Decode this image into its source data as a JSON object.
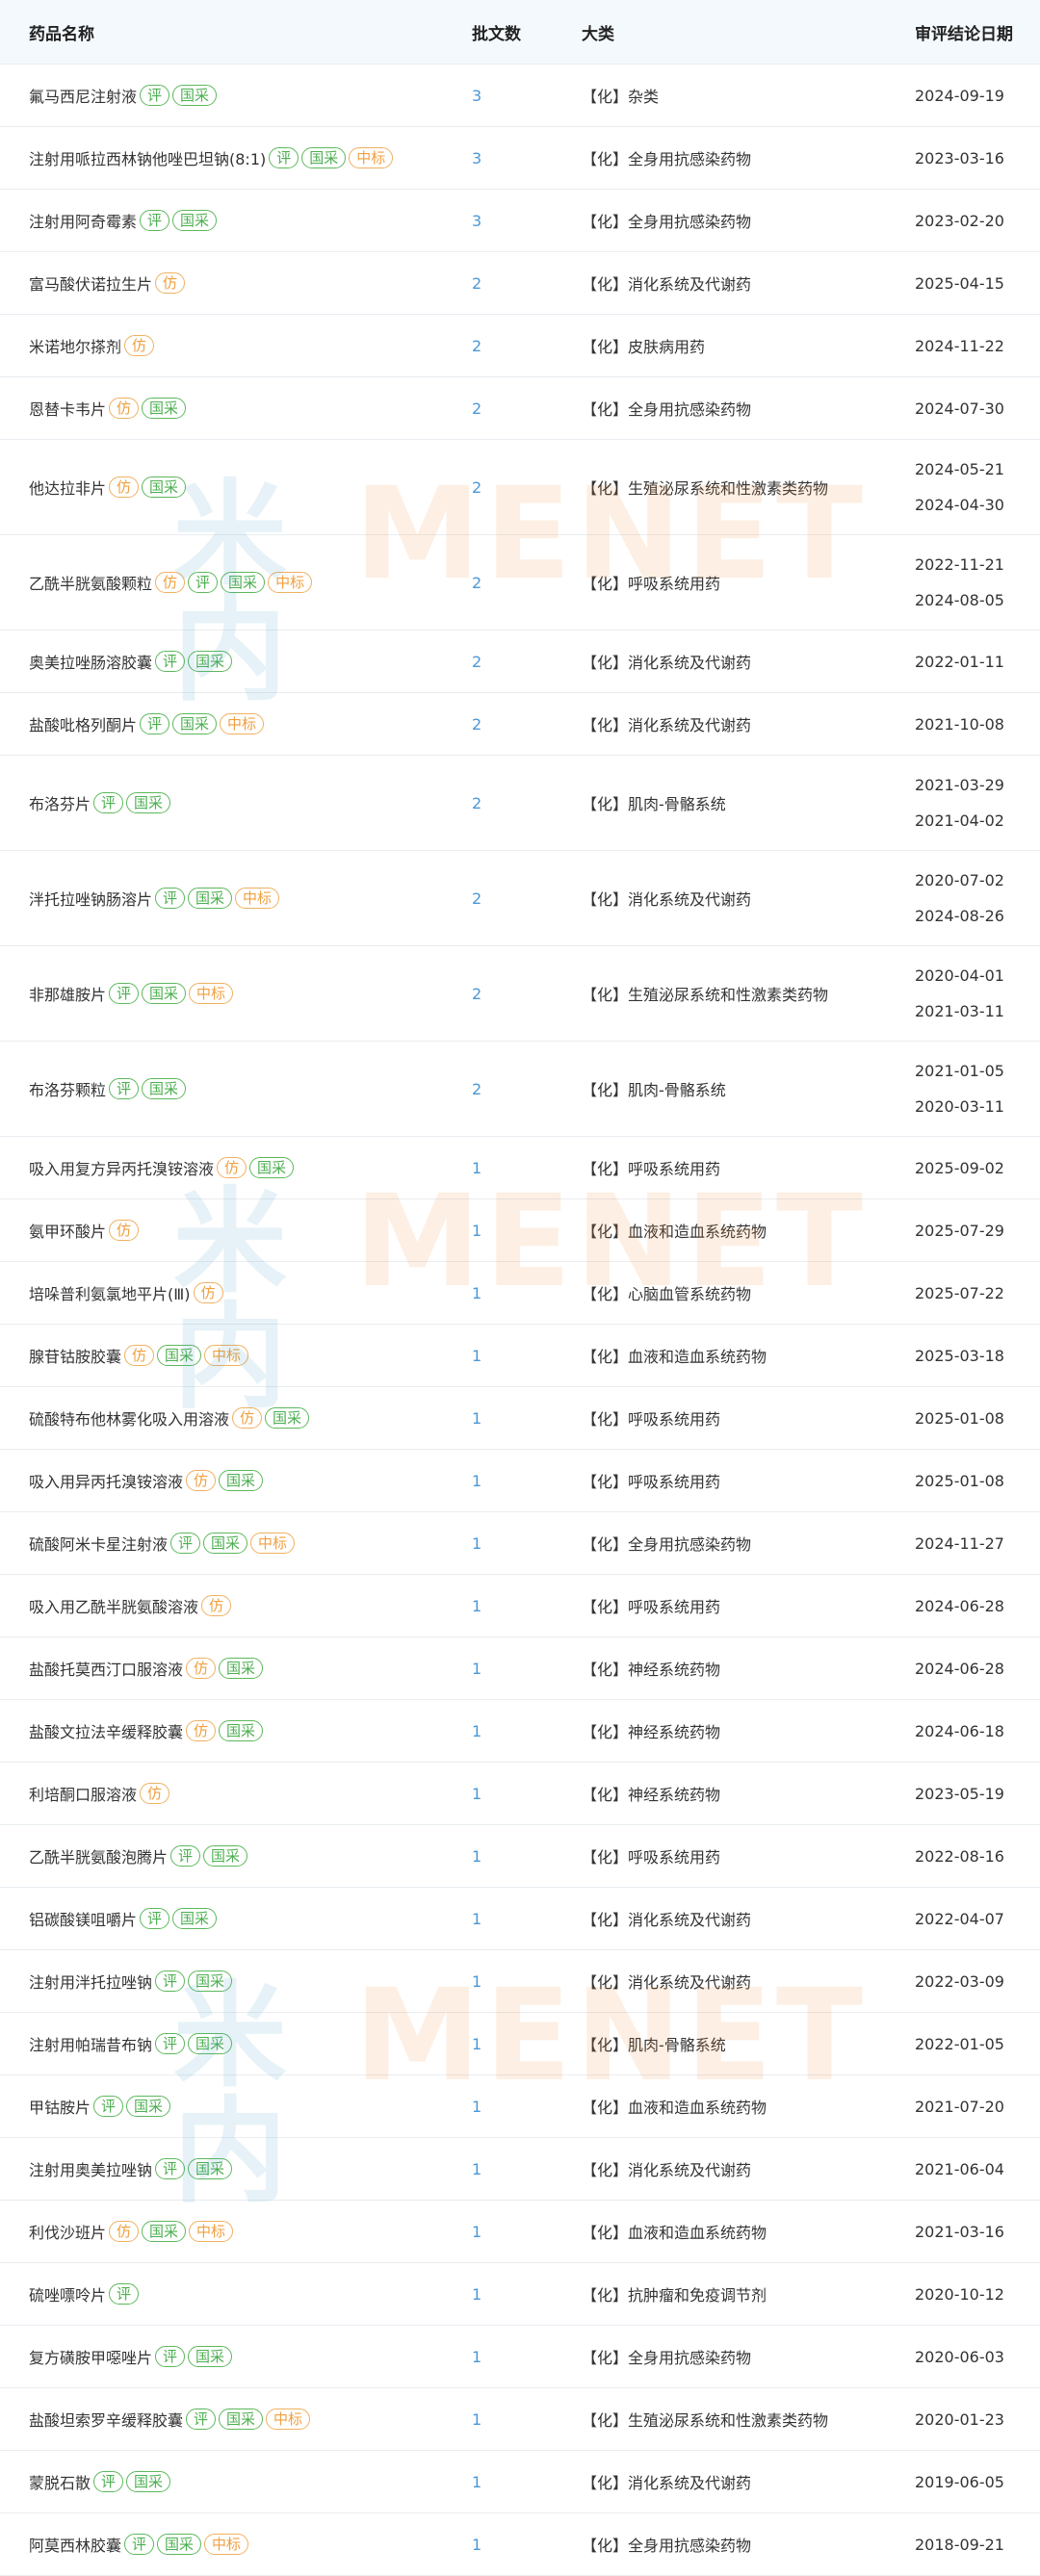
{
  "header": {
    "name": "药品名称",
    "count": "批文数",
    "category": "大类",
    "date": "审评结论日期"
  },
  "watermark": {
    "mark": "米内",
    "text": "MENET"
  },
  "colors": {
    "header_bg": "#f4f9fd",
    "count_blue": "#4a98d8",
    "tag_green": "#4caf50",
    "tag_orange": "#f0a040"
  },
  "rows": [
    {
      "name": "氟马西尼注射液",
      "tags": [
        "评",
        "国采"
      ],
      "count": "3",
      "category": "【化】杂类",
      "dates": [
        "2024-09-19"
      ]
    },
    {
      "name": "注射用哌拉西林钠他唑巴坦钠(8:1)",
      "tags": [
        "评",
        "国采",
        "中标"
      ],
      "count": "3",
      "category": "【化】全身用抗感染药物",
      "dates": [
        "2023-03-16"
      ]
    },
    {
      "name": "注射用阿奇霉素",
      "tags": [
        "评",
        "国采"
      ],
      "count": "3",
      "category": "【化】全身用抗感染药物",
      "dates": [
        "2023-02-20"
      ]
    },
    {
      "name": "富马酸伏诺拉生片",
      "tags": [
        "仿"
      ],
      "count": "2",
      "category": "【化】消化系统及代谢药",
      "dates": [
        "2025-04-15"
      ]
    },
    {
      "name": "米诺地尔搽剂",
      "tags": [
        "仿"
      ],
      "count": "2",
      "category": "【化】皮肤病用药",
      "dates": [
        "2024-11-22"
      ]
    },
    {
      "name": "恩替卡韦片",
      "tags": [
        "仿",
        "国采"
      ],
      "count": "2",
      "category": "【化】全身用抗感染药物",
      "dates": [
        "2024-07-30"
      ]
    },
    {
      "name": "他达拉非片",
      "tags": [
        "仿",
        "国采"
      ],
      "count": "2",
      "category": "【化】生殖泌尿系统和性激素类药物",
      "dates": [
        "2024-05-21",
        "2024-04-30"
      ]
    },
    {
      "name": "乙酰半胱氨酸颗粒",
      "tags": [
        "仿",
        "评",
        "国采",
        "中标"
      ],
      "count": "2",
      "category": "【化】呼吸系统用药",
      "dates": [
        "2022-11-21",
        "2024-08-05"
      ]
    },
    {
      "name": "奥美拉唑肠溶胶囊",
      "tags": [
        "评",
        "国采"
      ],
      "count": "2",
      "category": "【化】消化系统及代谢药",
      "dates": [
        "2022-01-11"
      ]
    },
    {
      "name": "盐酸吡格列酮片",
      "tags": [
        "评",
        "国采",
        "中标"
      ],
      "count": "2",
      "category": "【化】消化系统及代谢药",
      "dates": [
        "2021-10-08"
      ]
    },
    {
      "name": "布洛芬片",
      "tags": [
        "评",
        "国采"
      ],
      "count": "2",
      "category": "【化】肌肉-骨骼系统",
      "dates": [
        "2021-03-29",
        "2021-04-02"
      ]
    },
    {
      "name": "泮托拉唑钠肠溶片",
      "tags": [
        "评",
        "国采",
        "中标"
      ],
      "count": "2",
      "category": "【化】消化系统及代谢药",
      "dates": [
        "2020-07-02",
        "2024-08-26"
      ]
    },
    {
      "name": "非那雄胺片",
      "tags": [
        "评",
        "国采",
        "中标"
      ],
      "count": "2",
      "category": "【化】生殖泌尿系统和性激素类药物",
      "dates": [
        "2020-04-01",
        "2021-03-11"
      ]
    },
    {
      "name": "布洛芬颗粒",
      "tags": [
        "评",
        "国采"
      ],
      "count": "2",
      "category": "【化】肌肉-骨骼系统",
      "dates": [
        "2021-01-05",
        "2020-03-11"
      ]
    },
    {
      "name": "吸入用复方异丙托溴铵溶液",
      "tags": [
        "仿",
        "国采"
      ],
      "count": "1",
      "category": "【化】呼吸系统用药",
      "dates": [
        "2025-09-02"
      ]
    },
    {
      "name": "氨甲环酸片",
      "tags": [
        "仿"
      ],
      "count": "1",
      "category": "【化】血液和造血系统药物",
      "dates": [
        "2025-07-29"
      ]
    },
    {
      "name": "培哚普利氨氯地平片(Ⅲ)",
      "tags": [
        "仿"
      ],
      "count": "1",
      "category": "【化】心脑血管系统药物",
      "dates": [
        "2025-07-22"
      ]
    },
    {
      "name": "腺苷钴胺胶囊",
      "tags": [
        "仿",
        "国采",
        "中标"
      ],
      "count": "1",
      "category": "【化】血液和造血系统药物",
      "dates": [
        "2025-03-18"
      ]
    },
    {
      "name": "硫酸特布他林雾化吸入用溶液",
      "tags": [
        "仿",
        "国采"
      ],
      "count": "1",
      "category": "【化】呼吸系统用药",
      "dates": [
        "2025-01-08"
      ]
    },
    {
      "name": "吸入用异丙托溴铵溶液",
      "tags": [
        "仿",
        "国采"
      ],
      "count": "1",
      "category": "【化】呼吸系统用药",
      "dates": [
        "2025-01-08"
      ]
    },
    {
      "name": "硫酸阿米卡星注射液",
      "tags": [
        "评",
        "国采",
        "中标"
      ],
      "count": "1",
      "category": "【化】全身用抗感染药物",
      "dates": [
        "2024-11-27"
      ]
    },
    {
      "name": "吸入用乙酰半胱氨酸溶液",
      "tags": [
        "仿"
      ],
      "count": "1",
      "category": "【化】呼吸系统用药",
      "dates": [
        "2024-06-28"
      ]
    },
    {
      "name": "盐酸托莫西汀口服溶液",
      "tags": [
        "仿",
        "国采"
      ],
      "count": "1",
      "category": "【化】神经系统药物",
      "dates": [
        "2024-06-28"
      ]
    },
    {
      "name": "盐酸文拉法辛缓释胶囊",
      "tags": [
        "仿",
        "国采"
      ],
      "count": "1",
      "category": "【化】神经系统药物",
      "dates": [
        "2024-06-18"
      ]
    },
    {
      "name": "利培酮口服溶液",
      "tags": [
        "仿"
      ],
      "count": "1",
      "category": "【化】神经系统药物",
      "dates": [
        "2023-05-19"
      ]
    },
    {
      "name": "乙酰半胱氨酸泡腾片",
      "tags": [
        "评",
        "国采"
      ],
      "count": "1",
      "category": "【化】呼吸系统用药",
      "dates": [
        "2022-08-16"
      ]
    },
    {
      "name": "铝碳酸镁咀嚼片",
      "tags": [
        "评",
        "国采"
      ],
      "count": "1",
      "category": "【化】消化系统及代谢药",
      "dates": [
        "2022-04-07"
      ]
    },
    {
      "name": "注射用泮托拉唑钠",
      "tags": [
        "评",
        "国采"
      ],
      "count": "1",
      "category": "【化】消化系统及代谢药",
      "dates": [
        "2022-03-09"
      ]
    },
    {
      "name": "注射用帕瑞昔布钠",
      "tags": [
        "评",
        "国采"
      ],
      "count": "1",
      "category": "【化】肌肉-骨骼系统",
      "dates": [
        "2022-01-05"
      ]
    },
    {
      "name": "甲钴胺片",
      "tags": [
        "评",
        "国采"
      ],
      "count": "1",
      "category": "【化】血液和造血系统药物",
      "dates": [
        "2021-07-20"
      ]
    },
    {
      "name": "注射用奥美拉唑钠",
      "tags": [
        "评",
        "国采"
      ],
      "count": "1",
      "category": "【化】消化系统及代谢药",
      "dates": [
        "2021-06-04"
      ]
    },
    {
      "name": "利伐沙班片",
      "tags": [
        "仿",
        "国采",
        "中标"
      ],
      "count": "1",
      "category": "【化】血液和造血系统药物",
      "dates": [
        "2021-03-16"
      ]
    },
    {
      "name": "硫唑嘌呤片",
      "tags": [
        "评"
      ],
      "count": "1",
      "category": "【化】抗肿瘤和免疫调节剂",
      "dates": [
        "2020-10-12"
      ]
    },
    {
      "name": "复方磺胺甲噁唑片",
      "tags": [
        "评",
        "国采"
      ],
      "count": "1",
      "category": "【化】全身用抗感染药物",
      "dates": [
        "2020-06-03"
      ]
    },
    {
      "name": "盐酸坦索罗辛缓释胶囊",
      "tags": [
        "评",
        "国采",
        "中标"
      ],
      "count": "1",
      "category": "【化】生殖泌尿系统和性激素类药物",
      "dates": [
        "2020-01-23"
      ]
    },
    {
      "name": "蒙脱石散",
      "tags": [
        "评",
        "国采"
      ],
      "count": "1",
      "category": "【化】消化系统及代谢药",
      "dates": [
        "2019-06-05"
      ]
    },
    {
      "name": "阿莫西林胶囊",
      "tags": [
        "评",
        "国采",
        "中标"
      ],
      "count": "1",
      "category": "【化】全身用抗感染药物",
      "dates": [
        "2018-09-21"
      ]
    }
  ]
}
